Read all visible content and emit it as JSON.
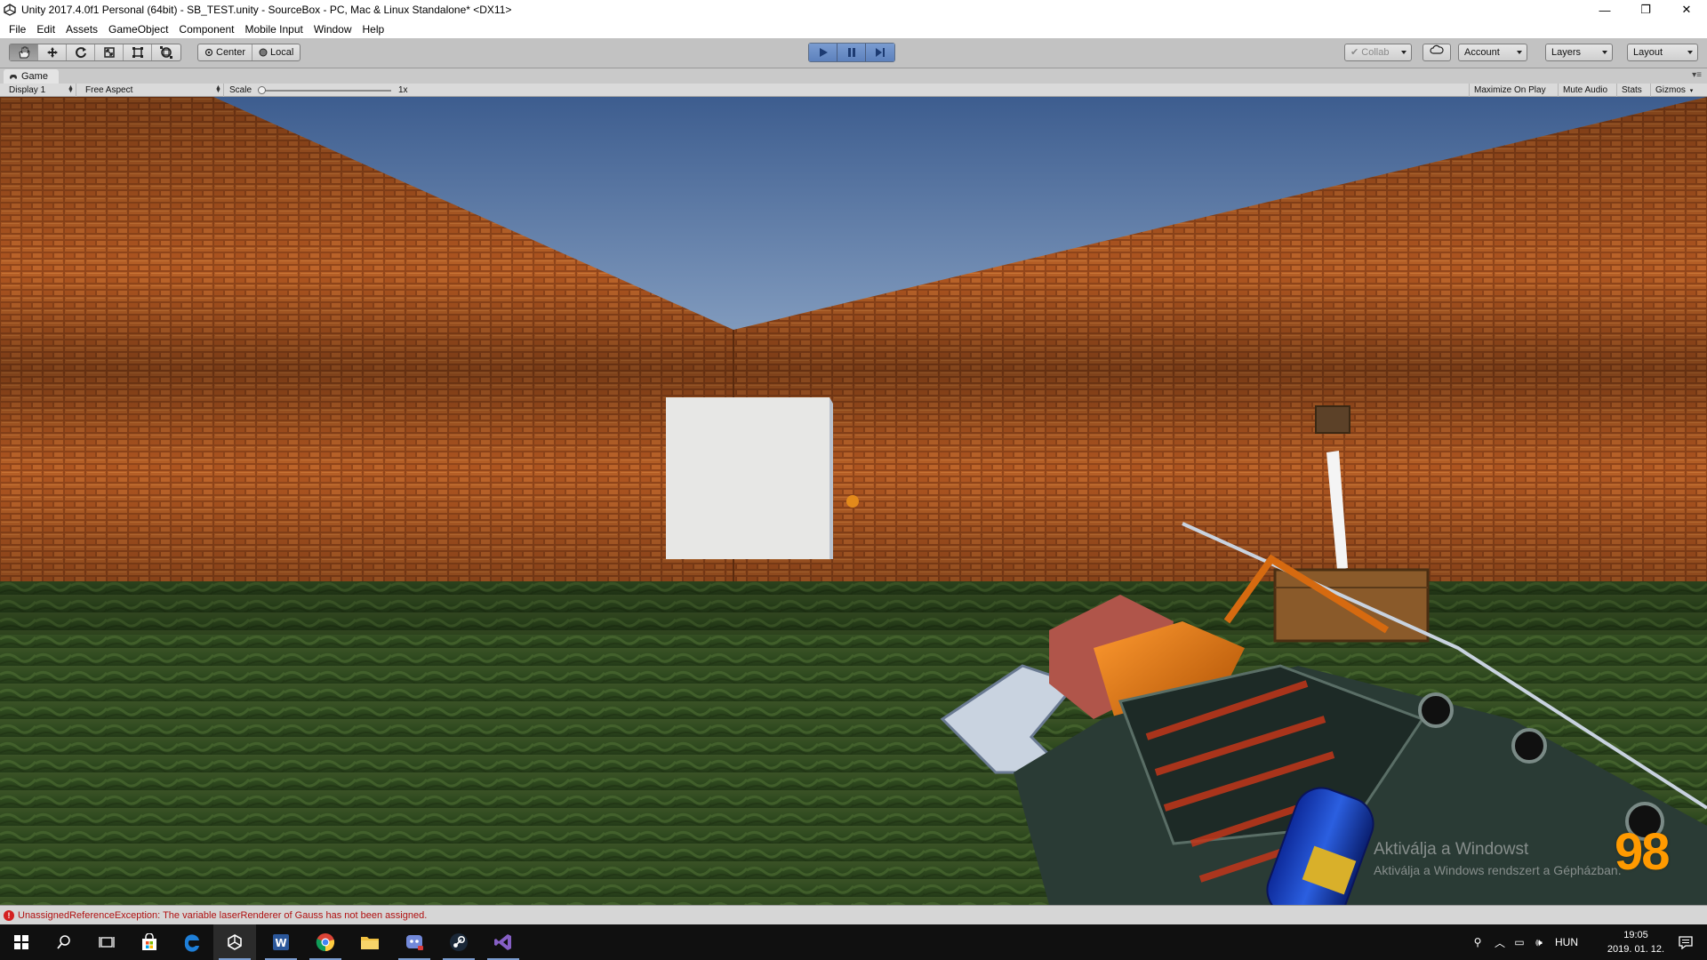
{
  "window": {
    "title": "Unity 2017.4.0f1 Personal (64bit) - SB_TEST.unity - SourceBox - PC, Mac & Linux Standalone* <DX11>",
    "controls": {
      "minimize": "—",
      "maximize": "❐",
      "close": "✕"
    }
  },
  "menu": [
    "File",
    "Edit",
    "Assets",
    "GameObject",
    "Component",
    "Mobile Input",
    "Window",
    "Help"
  ],
  "toolbar": {
    "tools": [
      {
        "name": "hand-tool",
        "icon": "hand-icon",
        "active": true
      },
      {
        "name": "move-tool",
        "icon": "move-icon"
      },
      {
        "name": "rotate-tool",
        "icon": "rotate-icon"
      },
      {
        "name": "scale-tool",
        "icon": "scale-icon"
      },
      {
        "name": "rect-tool",
        "icon": "rect-icon"
      },
      {
        "name": "transform-tool",
        "icon": "transform-icon"
      }
    ],
    "pivot": "Center",
    "space": "Local",
    "collab": "Collab",
    "account": "Account",
    "layers": "Layers",
    "layout": "Layout"
  },
  "game_tab": {
    "label": "Game"
  },
  "game_toolbar": {
    "display": "Display 1",
    "aspect": "Free Aspect",
    "scale_label": "Scale",
    "scale_value": "1x",
    "maximize": "Maximize On Play",
    "mute": "Mute Audio",
    "stats": "Stats",
    "gizmos": "Gizmos"
  },
  "hud": {
    "ammo": "98",
    "watermark_line1": "Aktiválja a Windowst",
    "watermark_line2": "Aktiválja a Windows rendszert a Gépházban."
  },
  "status": {
    "message": "UnassignedReferenceException: The variable laserRenderer of Gauss has not been assigned."
  },
  "taskbar": {
    "apps": [
      "start",
      "search",
      "task-view",
      "store",
      "edge",
      "unity",
      "word",
      "chrome",
      "explorer",
      "discord",
      "steam",
      "visual-studio"
    ],
    "language": "HUN",
    "time": "19:05",
    "date": "2019. 01. 12."
  },
  "colors": {
    "ammo": "#ff9a00",
    "crosshair": "#e38a1b",
    "play_accent": "#5d81bd"
  }
}
